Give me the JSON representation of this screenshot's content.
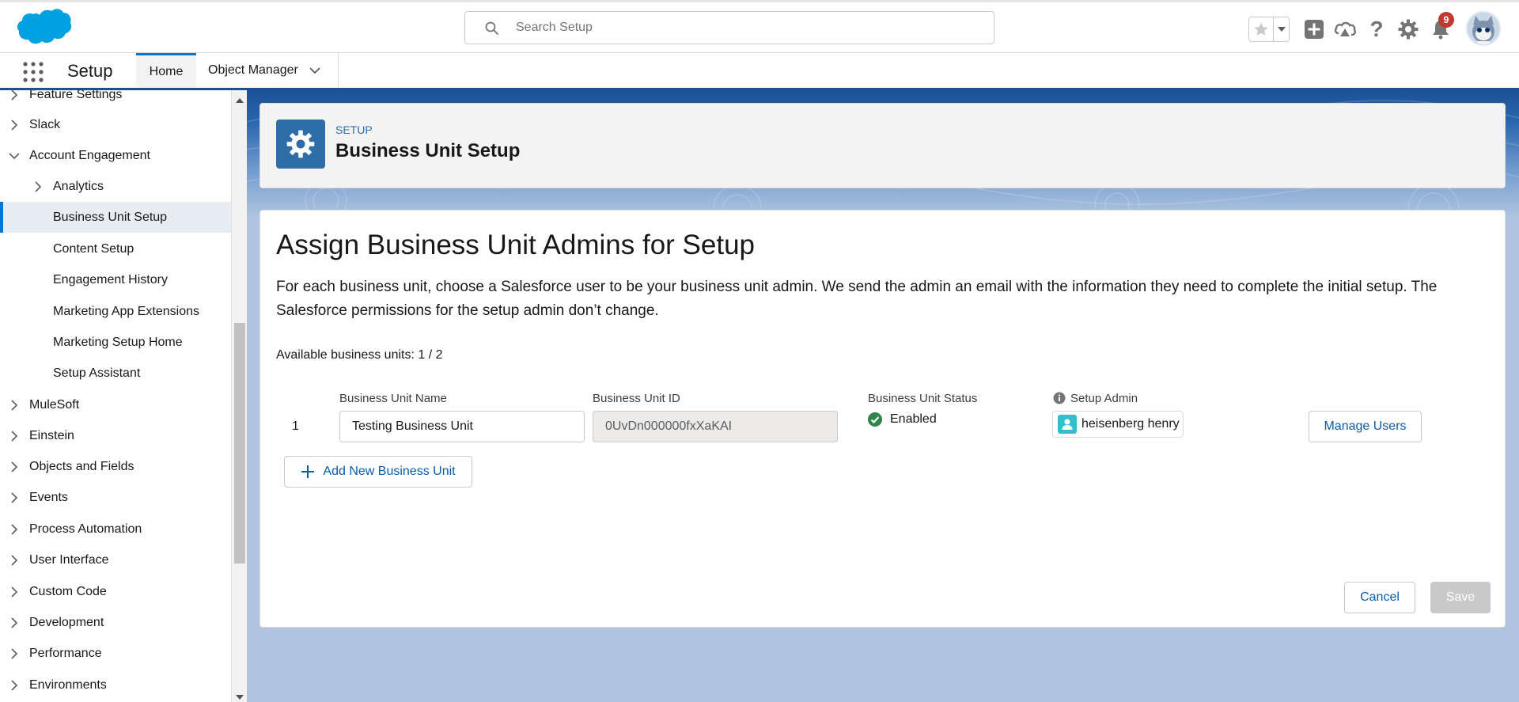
{
  "header": {
    "search_placeholder": "Search Setup",
    "notification_count": "9",
    "icons": [
      "salesforce-cloud-logo",
      "search-icon",
      "star-icon",
      "chevron-down-icon",
      "add-icon",
      "trailhead-icon",
      "help-icon",
      "gear-icon",
      "bell-icon",
      "avatar"
    ]
  },
  "context": {
    "app_name": "Setup",
    "tabs": [
      {
        "label": "Home"
      },
      {
        "label": "Object Manager"
      }
    ]
  },
  "sidebar": {
    "items": [
      {
        "label": "Feature Settings",
        "expandable": true,
        "expanded": false
      },
      {
        "label": "Slack",
        "expandable": true,
        "expanded": false
      },
      {
        "label": "Account Engagement",
        "expandable": true,
        "expanded": true
      },
      {
        "label": "Analytics",
        "expandable": true,
        "expanded": false
      },
      {
        "label": "Business Unit Setup",
        "selected": true
      },
      {
        "label": "Content Setup"
      },
      {
        "label": "Engagement History"
      },
      {
        "label": "Marketing App Extensions"
      },
      {
        "label": "Marketing Setup Home"
      },
      {
        "label": "Setup Assistant"
      },
      {
        "label": "MuleSoft",
        "expandable": true,
        "expanded": false
      },
      {
        "label": "Einstein",
        "expandable": true,
        "expanded": false
      },
      {
        "label": "Objects and Fields",
        "expandable": true,
        "expanded": false
      },
      {
        "label": "Events",
        "expandable": true,
        "expanded": false
      },
      {
        "label": "Process Automation",
        "expandable": true,
        "expanded": false
      },
      {
        "label": "User Interface",
        "expandable": true,
        "expanded": false
      },
      {
        "label": "Custom Code",
        "expandable": true,
        "expanded": false
      },
      {
        "label": "Development",
        "expandable": true,
        "expanded": false
      },
      {
        "label": "Performance",
        "expandable": true,
        "expanded": false
      },
      {
        "label": "Environments",
        "expandable": true,
        "expanded": false
      }
    ]
  },
  "page_header": {
    "eyebrow": "SETUP",
    "title": "Business Unit Setup"
  },
  "card": {
    "heading": "Assign Business Unit Admins for Setup",
    "description": "For each business unit, choose a Salesforce user to be your business unit admin. We send the admin an email with the information they need to complete the initial setup. The Salesforce permissions for the setup admin don’t change.",
    "available": "Available business units: 1 / 2",
    "columns": {
      "name": "Business Unit Name",
      "id": "Business Unit ID",
      "status": "Business Unit Status",
      "admin": "Setup Admin"
    },
    "rows": [
      {
        "num": "1",
        "name": "Testing Business Unit",
        "id": "0UvDn000000fxXaKAI",
        "status": "Enabled",
        "admin": "heisenberg henry",
        "manage_label": "Manage Users"
      }
    ],
    "add_label": "Add New Business Unit",
    "cancel_label": "Cancel",
    "save_label": "Save"
  },
  "colors": {
    "brand_blue": "#0176d3",
    "header_tile": "#2e6da8",
    "status_green": "#2e844a",
    "badge_red": "#c23934",
    "user_icon_teal": "#34becd"
  }
}
